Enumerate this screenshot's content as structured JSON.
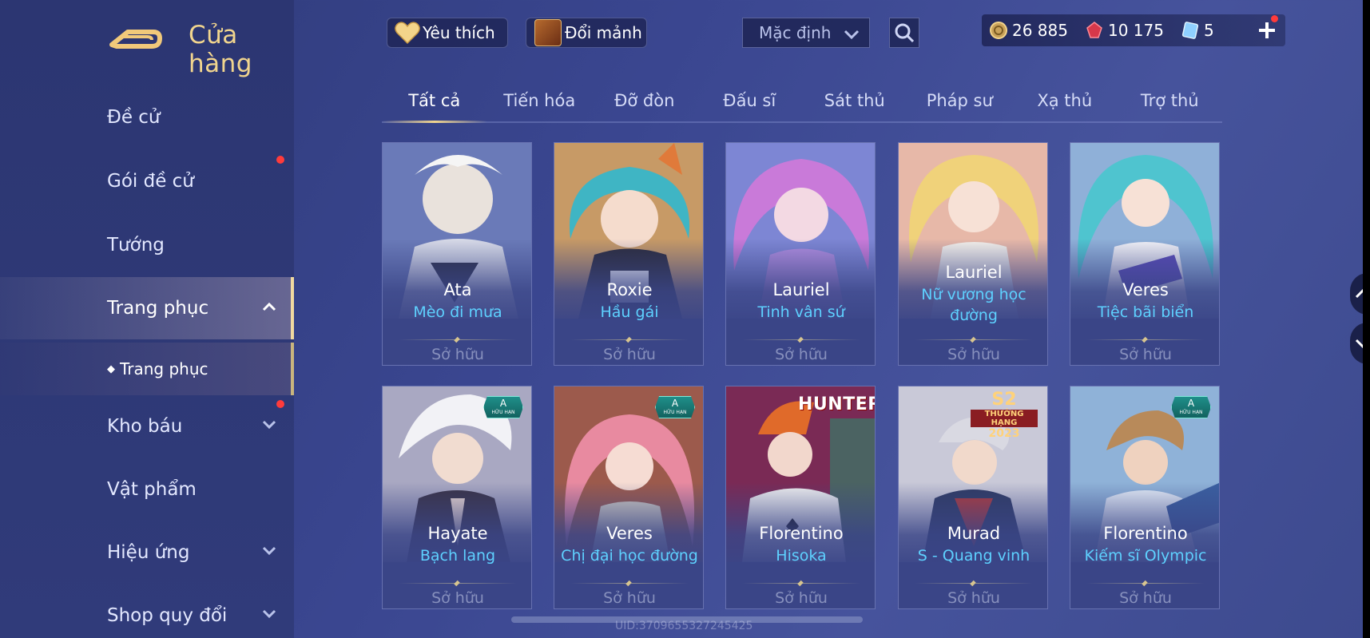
{
  "header": {
    "title": "Cửa hàng",
    "favorite_label": "Yêu thích",
    "exchange_label": "Đổi mảnh",
    "sort_value": "Mặc định"
  },
  "currency": {
    "gold": "26 885",
    "gems": "10 175",
    "vouchers": "5"
  },
  "sidebar": {
    "items": [
      {
        "label": "Đề cử"
      },
      {
        "label": "Gói đề cử"
      },
      {
        "label": "Tướng"
      },
      {
        "label": "Trang phục"
      },
      {
        "label": "Kho báu"
      },
      {
        "label": "Vật phẩm"
      },
      {
        "label": "Hiệu ứng"
      },
      {
        "label": "Shop quy đổi"
      }
    ],
    "sub_item": "Trang phục"
  },
  "tabs": [
    "Tất cả",
    "Tiến hóa",
    "Đỡ đòn",
    "Đấu sĩ",
    "Sát thủ",
    "Pháp sư",
    "Xạ thủ",
    "Trợ thủ"
  ],
  "cards": [
    {
      "hero": "Ata",
      "skin": "Mèo đi mưa",
      "status": "Sở hữu"
    },
    {
      "hero": "Roxie",
      "skin": "Hầu gái",
      "status": "Sở hữu"
    },
    {
      "hero": "Lauriel",
      "skin": "Tinh vân sứ",
      "status": "Sở hữu"
    },
    {
      "hero": "Lauriel",
      "skin": "Nữ vương học đường",
      "status": "Sở hữu"
    },
    {
      "hero": "Veres",
      "skin": "Tiệc bãi biển",
      "status": "Sở hữu"
    },
    {
      "hero": "Hayate",
      "skin": "Bạch lang",
      "status": "Sở hữu",
      "badge": "A"
    },
    {
      "hero": "Veres",
      "skin": "Chị đại học đường",
      "status": "Sở hữu",
      "badge": "A"
    },
    {
      "hero": "Florentino",
      "skin": "Hisoka",
      "status": "Sở hữu",
      "overlay": "HUNTER"
    },
    {
      "hero": "Murad",
      "skin": "S - Quang vinh",
      "status": "Sở hữu",
      "overlay_s2": "S2",
      "overlay_s2_sub": "THƯỞNG HẠNG",
      "overlay_s2_year": "2023"
    },
    {
      "hero": "Florentino",
      "skin": "Kiếm sĩ Olympic",
      "status": "Sở hữu",
      "badge": "A"
    }
  ],
  "badge_sub": "HỮU HẠN",
  "uid": "UID:3709655327245425",
  "colors": {
    "accent_gold": "#f1d58e",
    "skin_name": "#5ed1ff",
    "bg": "#3a4690"
  }
}
